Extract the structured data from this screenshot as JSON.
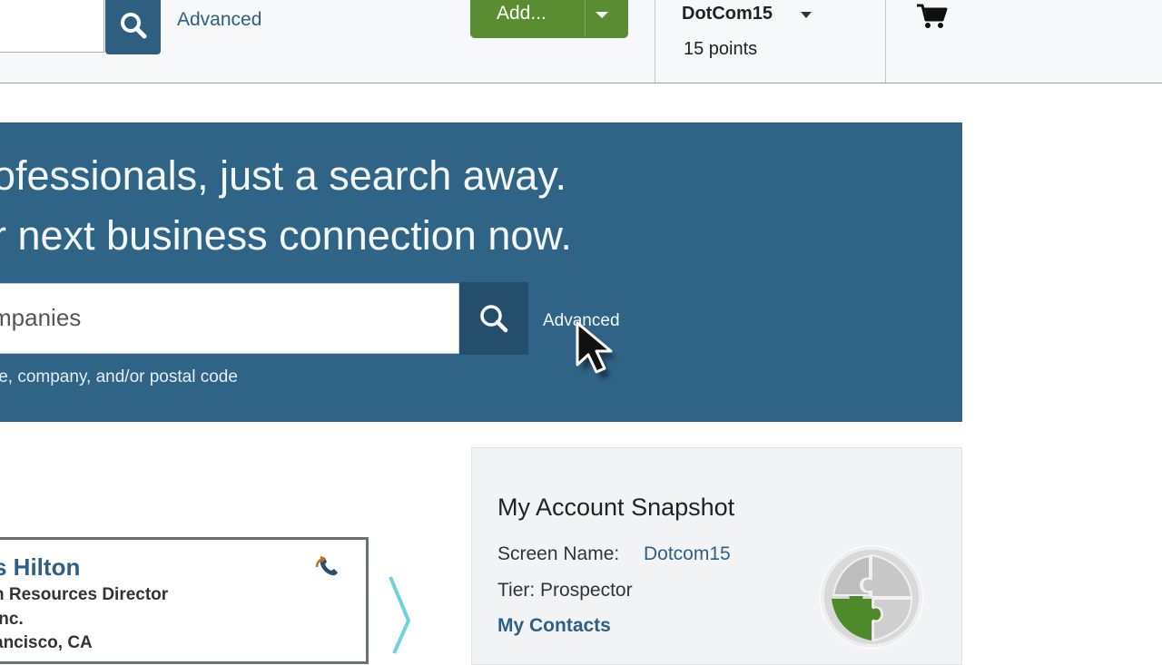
{
  "header": {
    "advanced_link": "Advanced",
    "add_button": "Add...",
    "account_name": "DotCom15",
    "account_points": "15 points",
    "icons": [
      "search-icon",
      "chevron-down-icon",
      "cart-icon"
    ]
  },
  "hero": {
    "line1": "ofessionals, just a search away.",
    "line2": "r next business connection now.",
    "search_value": "mpanies",
    "advanced_link": "Advanced",
    "hint": "le, company, and/or postal code"
  },
  "contact_card": {
    "name": "s Hilton",
    "title": "n Resources Director",
    "company": " Inc.",
    "location": "ancisco, CA"
  },
  "snapshot": {
    "title": "My Account Snapshot",
    "screen_name_label": "Screen Name:",
    "screen_name_value": "Dotcom15",
    "tier": "Tier: Prospector",
    "my_contacts": "My Contacts"
  },
  "colors": {
    "brand_blue": "#2f6487",
    "button_dark": "#244e6c",
    "add_green": "#5a8c32",
    "link_blue": "#2e5f86"
  }
}
